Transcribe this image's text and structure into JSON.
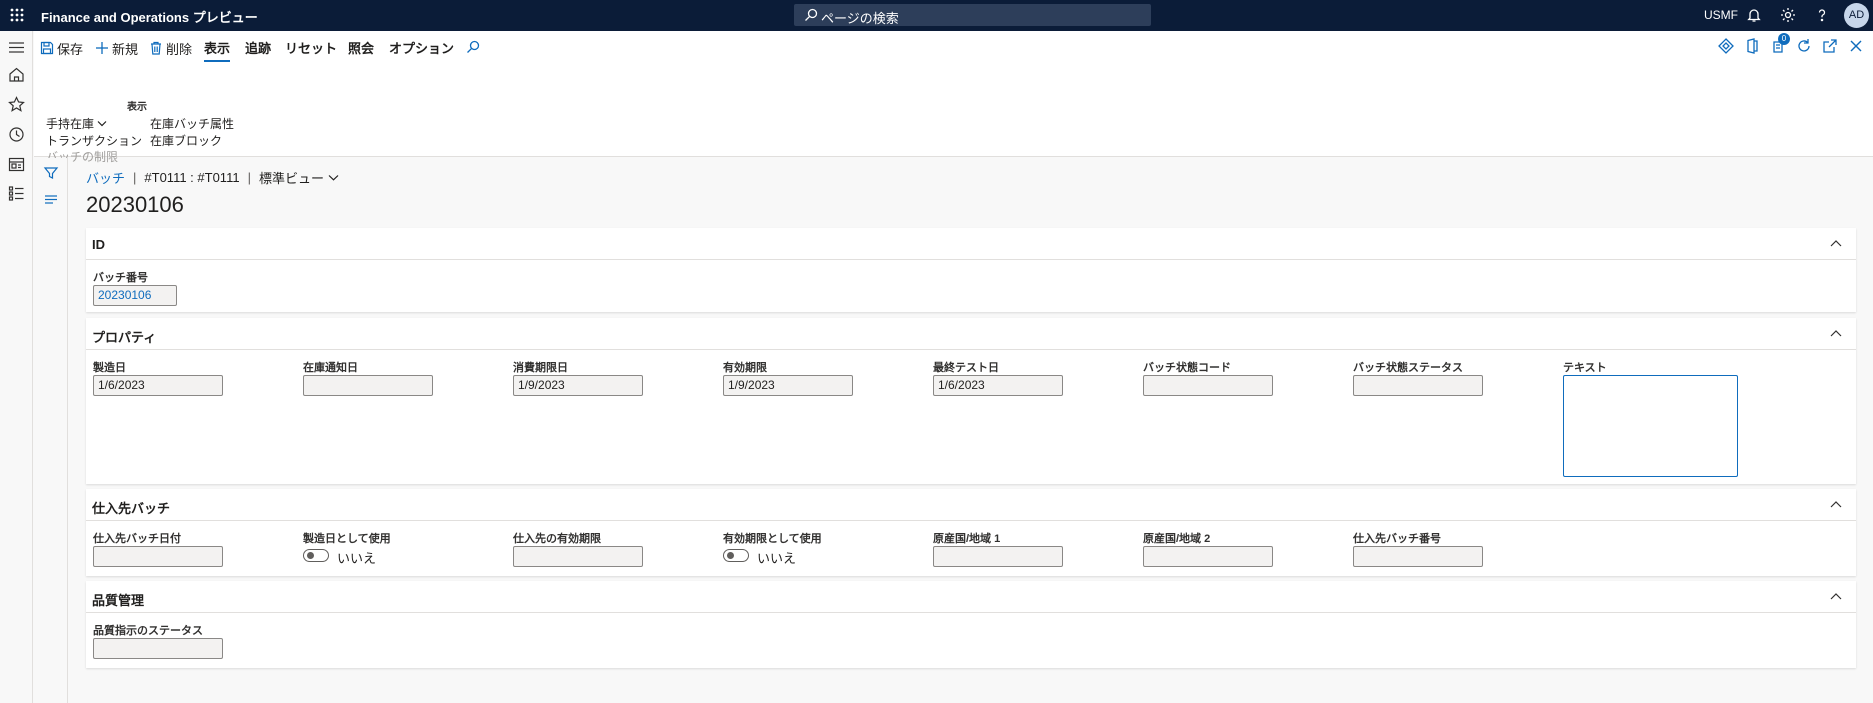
{
  "topbar": {
    "app_title": "Finance and Operations プレビュー",
    "search_placeholder": "ページの検索",
    "company": "USMF",
    "user_initials": "AD"
  },
  "actions": {
    "save": "保存",
    "new": "新規",
    "delete": "削除",
    "tabs": [
      "表示",
      "追跡",
      "リセット",
      "照会",
      "オプション"
    ],
    "active_tab": "表示",
    "notification_count": "0"
  },
  "ribbon": {
    "group_label": "表示",
    "col1": [
      "手持在庫",
      "トランザクション",
      "バッチの制限"
    ],
    "col2": [
      "在庫バッチ属性",
      "在庫ブロック"
    ]
  },
  "breadcrumb": {
    "link": "バッチ",
    "context": "#T0111 : #T0111",
    "view": "標準ビュー"
  },
  "record": {
    "title": "20230106"
  },
  "sections": {
    "id": {
      "title": "ID",
      "batch_number_label": "バッチ番号",
      "batch_number_value": "20230106"
    },
    "properties": {
      "title": "プロパティ",
      "manufacturing_date": {
        "label": "製造日",
        "value": "1/6/2023"
      },
      "shelf_advice_date": {
        "label": "在庫通知日",
        "value": ""
      },
      "best_before_date": {
        "label": "消費期限日",
        "value": "1/9/2023"
      },
      "expiration_date": {
        "label": "有効期限",
        "value": "1/9/2023"
      },
      "last_test_date": {
        "label": "最終テスト日",
        "value": "1/6/2023"
      },
      "disposition_code": {
        "label": "バッチ状態コード",
        "value": ""
      },
      "disposition_status": {
        "label": "バッチ状態ステータス",
        "value": ""
      },
      "text": {
        "label": "テキスト",
        "value": ""
      }
    },
    "vendor_batch": {
      "title": "仕入先バッチ",
      "vendor_batch_date": {
        "label": "仕入先バッチ日付",
        "value": ""
      },
      "use_as_manufacturing_date": {
        "label": "製造日として使用",
        "value": "いいえ"
      },
      "vendor_expiration": {
        "label": "仕入先の有効期限",
        "value": ""
      },
      "use_as_expiration": {
        "label": "有効期限として使用",
        "value": "いいえ"
      },
      "country1": {
        "label": "原産国/地域 1",
        "value": ""
      },
      "country2": {
        "label": "原産国/地域 2",
        "value": ""
      },
      "vendor_batch_number": {
        "label": "仕入先バッチ番号",
        "value": ""
      }
    },
    "quality": {
      "title": "品質管理",
      "quality_order_status": {
        "label": "品質指示のステータス",
        "value": ""
      }
    }
  }
}
